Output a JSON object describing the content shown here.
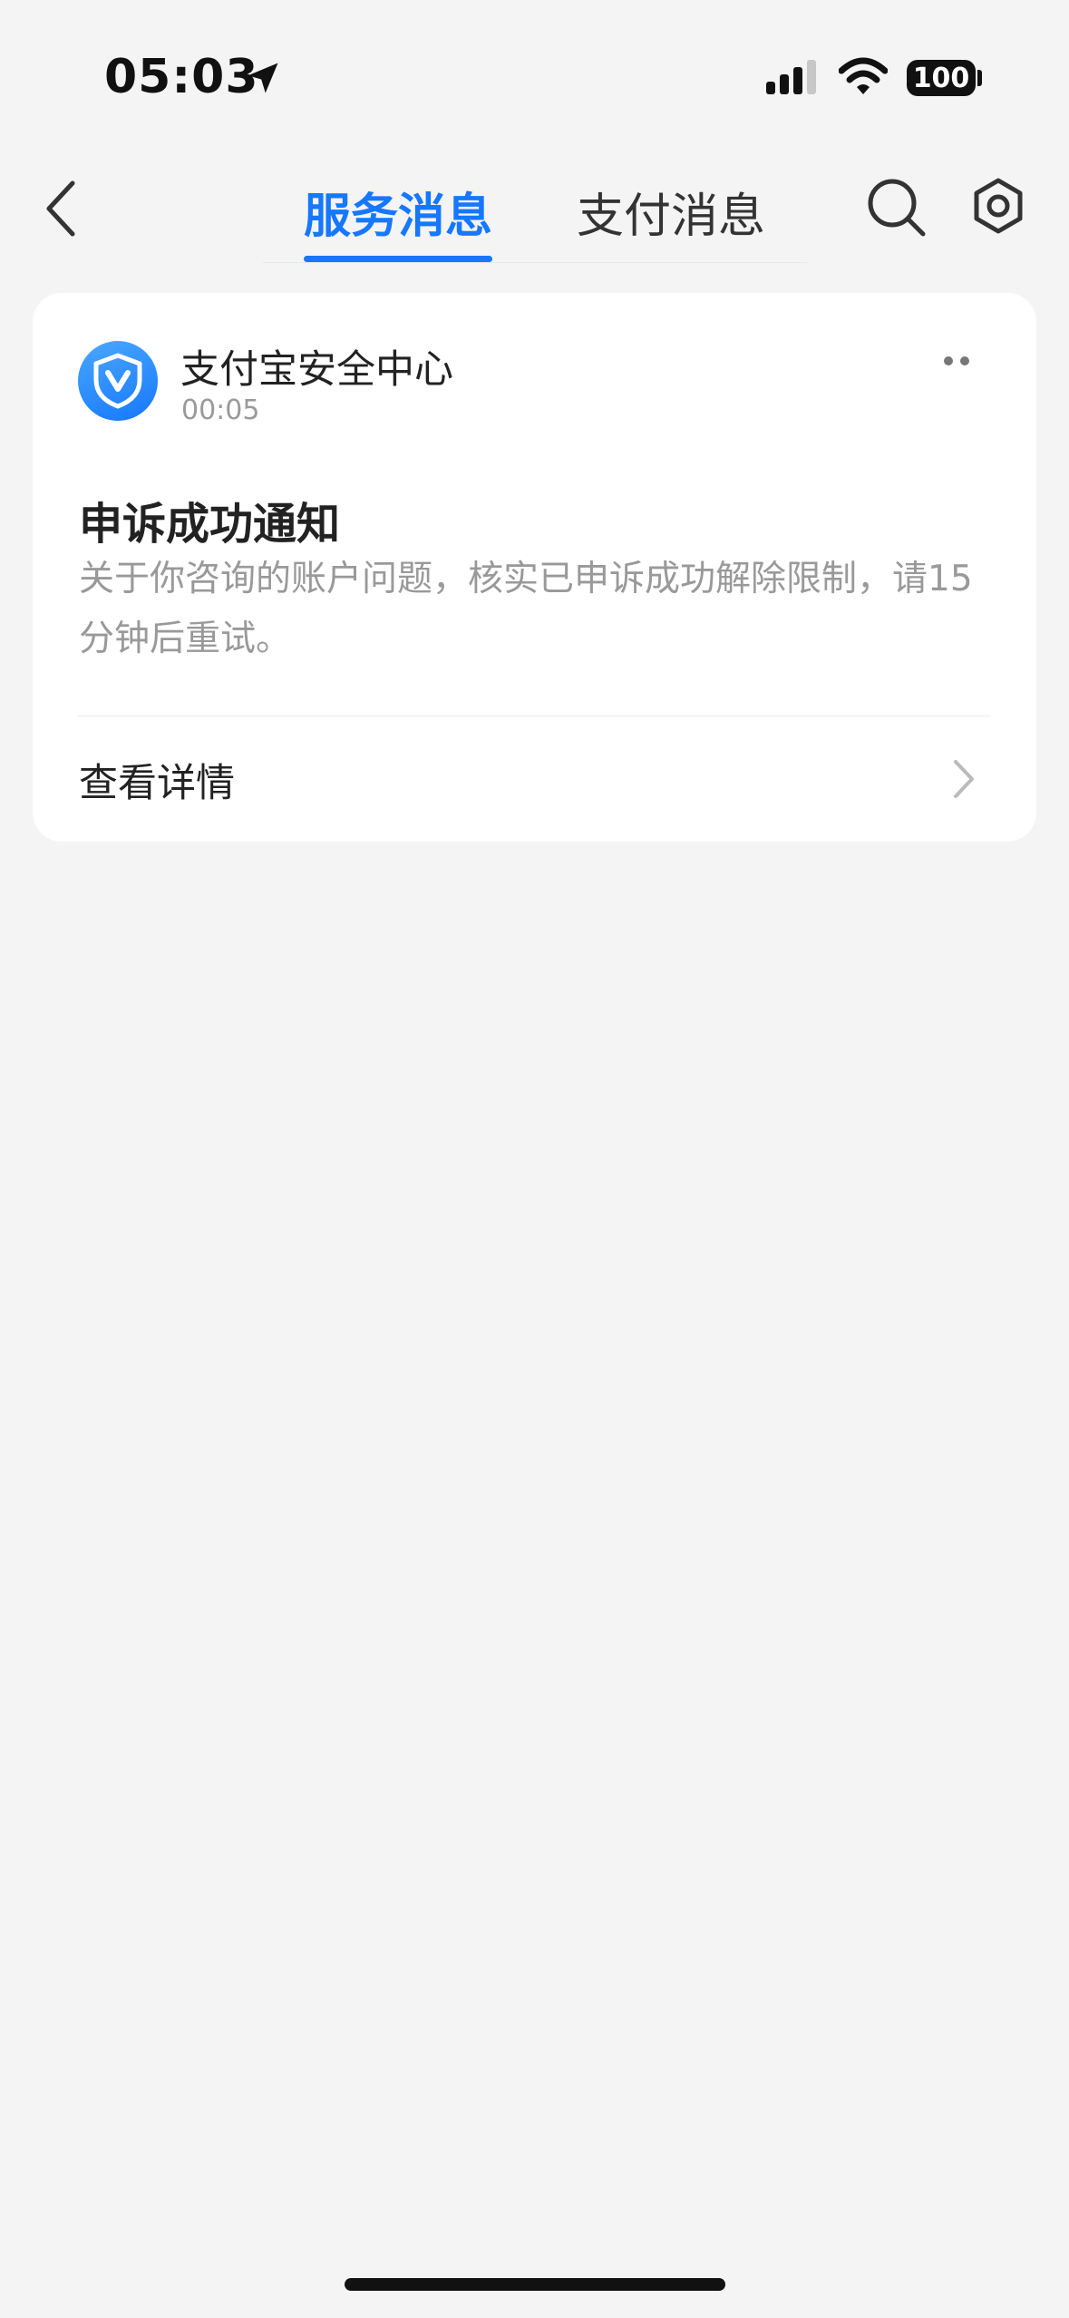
{
  "status_bar": {
    "time": "05:03",
    "battery": "100"
  },
  "nav": {
    "tabs": [
      {
        "label": "服务消息",
        "active": true
      },
      {
        "label": "支付消息",
        "active": false
      }
    ]
  },
  "message": {
    "sender": "支付宝安全中心",
    "time": "00:05",
    "title": "申诉成功通知",
    "body": "关于你咨询的账户问题，核实已申诉成功解除限制，请15分钟后重试。",
    "action_label": "查看详情"
  },
  "colors": {
    "accent": "#1677ff",
    "background": "#f4f4f4",
    "card": "#ffffff",
    "muted_text": "#999999"
  }
}
